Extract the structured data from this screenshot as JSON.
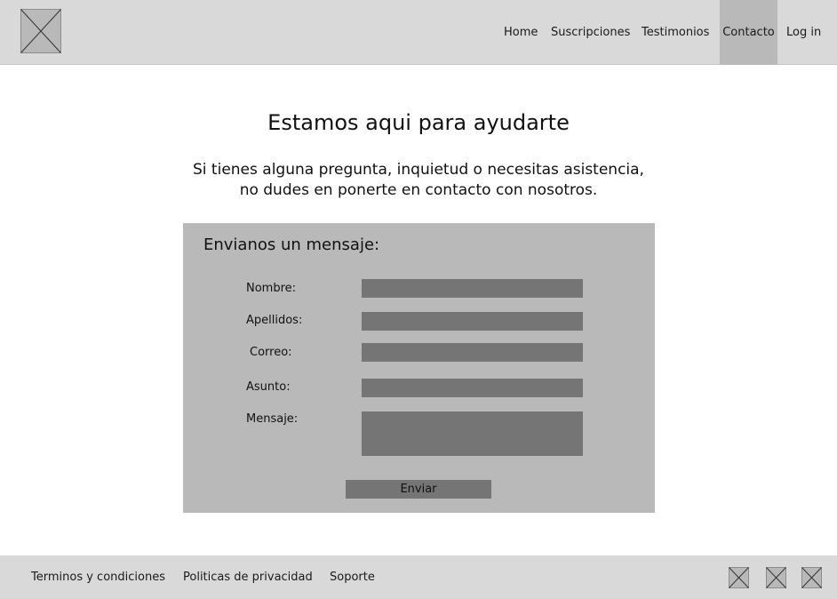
{
  "header": {
    "logo": "placeholder-image-icon",
    "nav": [
      {
        "label": "Home"
      },
      {
        "label": "Suscripciones"
      },
      {
        "label": "Testimonios"
      },
      {
        "label": "Contacto",
        "active": true
      },
      {
        "label": "Log in"
      }
    ]
  },
  "main": {
    "title": "Estamos aqui para ayudarte",
    "intro_line1": "Si tienes alguna pregunta, inquietud o necesitas asistencia,",
    "intro_line2": "no dudes en ponerte en contacto con nosotros."
  },
  "form": {
    "title": "Envianos un mensaje:",
    "fields": [
      {
        "label": "Nombre:",
        "value": ""
      },
      {
        "label": "Apellidos:",
        "value": ""
      },
      {
        "label": "Correo:",
        "value": ""
      },
      {
        "label": "Asunto:",
        "value": ""
      },
      {
        "label": "Mensaje:",
        "value": ""
      }
    ],
    "submit_label": "Enviar"
  },
  "footer": {
    "links": [
      {
        "label": "Terminos y condiciones"
      },
      {
        "label": "Politicas de privacidad"
      },
      {
        "label": "Soporte"
      }
    ],
    "social_icons": [
      "placeholder-image-icon",
      "placeholder-image-icon",
      "placeholder-image-icon"
    ]
  },
  "colors": {
    "header_bg": "#d9d9d9",
    "active_nav_bg": "#b9b9b9",
    "form_panel_bg": "#b9b9b9",
    "input_bg": "#757575",
    "footer_bg": "#d9d9d9"
  }
}
